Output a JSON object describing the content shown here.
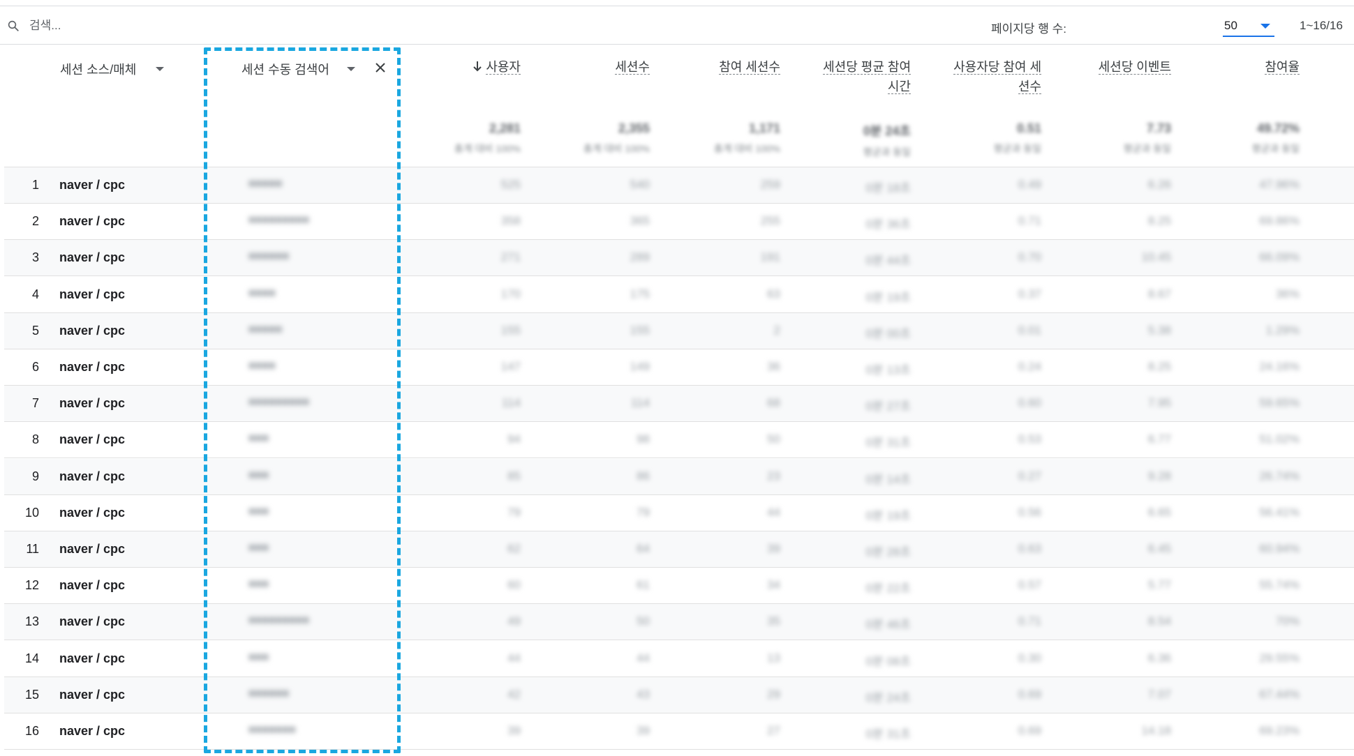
{
  "toolbar": {
    "search_placeholder": "검색...",
    "rows_per_page_label": "페이지당 행 수:",
    "rows_per_page_value": "50",
    "pagination": "1~16/16"
  },
  "headers": {
    "source_medium": "세션 소스/매체",
    "keyword": "세션 수동 검색어",
    "metrics": [
      "사용자",
      "세션수",
      "참여 세션수",
      "세션당 평균 참여 시간",
      "사용자당 참여 세션수",
      "세션당 이벤트",
      "참여율"
    ]
  },
  "totals": {
    "values": [
      "2,281",
      "2,355",
      "1,171",
      "0분 24초",
      "0.51",
      "7.73",
      "49.72%"
    ],
    "subs": [
      "총계 대비 100%",
      "총계 대비 100%",
      "총계 대비 100%",
      "평균과 동일",
      "평균과 동일",
      "평균과 동일",
      "평균과 동일"
    ]
  },
  "rows": [
    {
      "n": "1",
      "src": "naver / cpc",
      "kw": "■■■■■",
      "m": [
        "525",
        "540",
        "259",
        "0분 18초",
        "0.49",
        "6.26",
        "47.96%"
      ]
    },
    {
      "n": "2",
      "src": "naver / cpc",
      "kw": "■■■■■■■■■",
      "m": [
        "358",
        "365",
        "255",
        "0분 36초",
        "0.71",
        "8.25",
        "69.86%"
      ]
    },
    {
      "n": "3",
      "src": "naver / cpc",
      "kw": "■■■■■■",
      "m": [
        "271",
        "289",
        "191",
        "0분 44초",
        "0.70",
        "10.45",
        "66.09%"
      ]
    },
    {
      "n": "4",
      "src": "naver / cpc",
      "kw": "■■■■",
      "m": [
        "170",
        "175",
        "63",
        "0분 19초",
        "0.37",
        "8.67",
        "36%"
      ]
    },
    {
      "n": "5",
      "src": "naver / cpc",
      "kw": "■■■■■",
      "m": [
        "155",
        "155",
        "2",
        "0분 00초",
        "0.01",
        "5.38",
        "1.29%"
      ]
    },
    {
      "n": "6",
      "src": "naver / cpc",
      "kw": "■■■■",
      "m": [
        "147",
        "149",
        "36",
        "0분 13초",
        "0.24",
        "8.25",
        "24.16%"
      ]
    },
    {
      "n": "7",
      "src": "naver / cpc",
      "kw": "■■■■■■■■■",
      "m": [
        "114",
        "114",
        "68",
        "0분 27초",
        "0.60",
        "7.95",
        "59.65%"
      ]
    },
    {
      "n": "8",
      "src": "naver / cpc",
      "kw": "■■■",
      "m": [
        "94",
        "98",
        "50",
        "0분 31초",
        "0.53",
        "6.77",
        "51.02%"
      ]
    },
    {
      "n": "9",
      "src": "naver / cpc",
      "kw": "■■■",
      "m": [
        "85",
        "86",
        "23",
        "0분 14초",
        "0.27",
        "9.28",
        "26.74%"
      ]
    },
    {
      "n": "10",
      "src": "naver / cpc",
      "kw": "■■■",
      "m": [
        "79",
        "79",
        "44",
        "0분 19초",
        "0.56",
        "6.65",
        "56.41%"
      ]
    },
    {
      "n": "11",
      "src": "naver / cpc",
      "kw": "■■■",
      "m": [
        "62",
        "64",
        "39",
        "0분 28초",
        "0.63",
        "6.45",
        "60.94%"
      ]
    },
    {
      "n": "12",
      "src": "naver / cpc",
      "kw": "■■■",
      "m": [
        "60",
        "61",
        "34",
        "0분 22초",
        "0.57",
        "5.77",
        "55.74%"
      ]
    },
    {
      "n": "13",
      "src": "naver / cpc",
      "kw": "■■■■■■■■■",
      "m": [
        "49",
        "50",
        "35",
        "0분 46초",
        "0.71",
        "8.54",
        "70%"
      ]
    },
    {
      "n": "14",
      "src": "naver / cpc",
      "kw": "■■■",
      "m": [
        "44",
        "44",
        "13",
        "0분 08초",
        "0.30",
        "6.36",
        "29.55%"
      ]
    },
    {
      "n": "15",
      "src": "naver / cpc",
      "kw": "■■■■■■",
      "m": [
        "42",
        "43",
        "29",
        "0분 24초",
        "0.69",
        "7.07",
        "67.44%"
      ]
    },
    {
      "n": "16",
      "src": "naver / cpc",
      "kw": "■■■■■■■",
      "m": [
        "39",
        "39",
        "27",
        "0분 31초",
        "0.69",
        "14.18",
        "69.23%"
      ]
    }
  ],
  "colors": {
    "accent": "#1a73e8",
    "highlight_border": "#1aa7e0"
  }
}
